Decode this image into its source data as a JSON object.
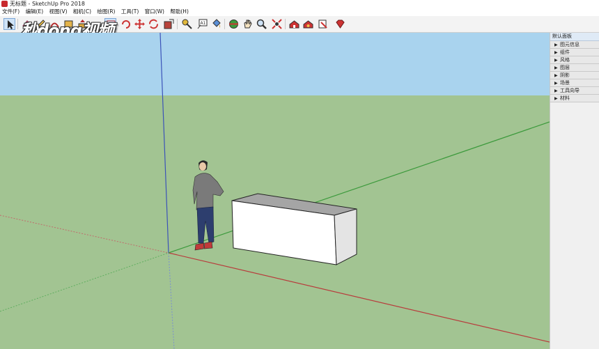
{
  "window": {
    "title": "无标题 - SketchUp Pro 2018"
  },
  "menu": [
    {
      "label": "文件(F)"
    },
    {
      "label": "编辑(E)"
    },
    {
      "label": "视图(V)"
    },
    {
      "label": "相机(C)"
    },
    {
      "label": "绘图(R)"
    },
    {
      "label": "工具(T)"
    },
    {
      "label": "窗口(W)"
    },
    {
      "label": "帮助(H)"
    }
  ],
  "watermark": {
    "text": "秒dong视频"
  },
  "toolbar": {
    "tools": [
      {
        "name": "select-tool",
        "icon": "arrow-cursor-icon",
        "active": true
      },
      {
        "name": "eraser-tool",
        "icon": "eraser-icon"
      },
      {
        "name": "line-tool",
        "icon": "pencil-icon"
      },
      {
        "name": "arc-tool",
        "icon": "arc-icon"
      },
      {
        "name": "shapes-tool",
        "icon": "rectangle-icon"
      },
      {
        "name": "pushpull-tool",
        "icon": "pushpull-icon"
      },
      {
        "name": "offset-tool",
        "icon": "offset-icon"
      },
      {
        "name": "move-tool",
        "icon": "move-icon"
      },
      {
        "name": "rotate-tool",
        "icon": "rotate-icon"
      },
      {
        "name": "scale-tool",
        "icon": "scale-icon"
      },
      {
        "name": "tape-measure-tool",
        "icon": "tape-measure-icon"
      },
      {
        "name": "text-tool",
        "icon": "text-icon"
      },
      {
        "name": "paint-bucket-tool",
        "icon": "paint-bucket-icon"
      },
      {
        "name": "orbit-tool",
        "icon": "orbit-icon"
      },
      {
        "name": "pan-tool",
        "icon": "pan-icon"
      },
      {
        "name": "zoom-tool",
        "icon": "zoom-icon"
      },
      {
        "name": "zoom-extents-tool",
        "icon": "zoom-extents-icon"
      },
      {
        "name": "3d-warehouse-tool",
        "icon": "warehouse-icon"
      },
      {
        "name": "extension-warehouse-tool",
        "icon": "extension-warehouse-icon"
      },
      {
        "name": "layout-tool",
        "icon": "layout-icon"
      },
      {
        "name": "extension-manager-tool",
        "icon": "ruby-gem-icon"
      }
    ]
  },
  "tray": {
    "title": "默认面板",
    "panels": [
      {
        "label": "图元信息"
      },
      {
        "label": "组件"
      },
      {
        "label": "风格"
      },
      {
        "label": "图层"
      },
      {
        "label": "阴影"
      },
      {
        "label": "场景"
      },
      {
        "label": "工具向导"
      },
      {
        "label": "材料"
      }
    ]
  },
  "scene": {
    "sky_color": "#a9d3ee",
    "ground_color": "#a2c492",
    "red_axis_color": "#b83c3c",
    "green_axis_color": "#3c9a3c",
    "blue_axis_color": "#3b52b8",
    "box_face_color": "#ffffff",
    "box_top_color": "#a5a5a5",
    "figure": {
      "shirt": "#7a7a7a",
      "jeans": "#2d3e6e",
      "skin": "#e9c9a8"
    }
  }
}
